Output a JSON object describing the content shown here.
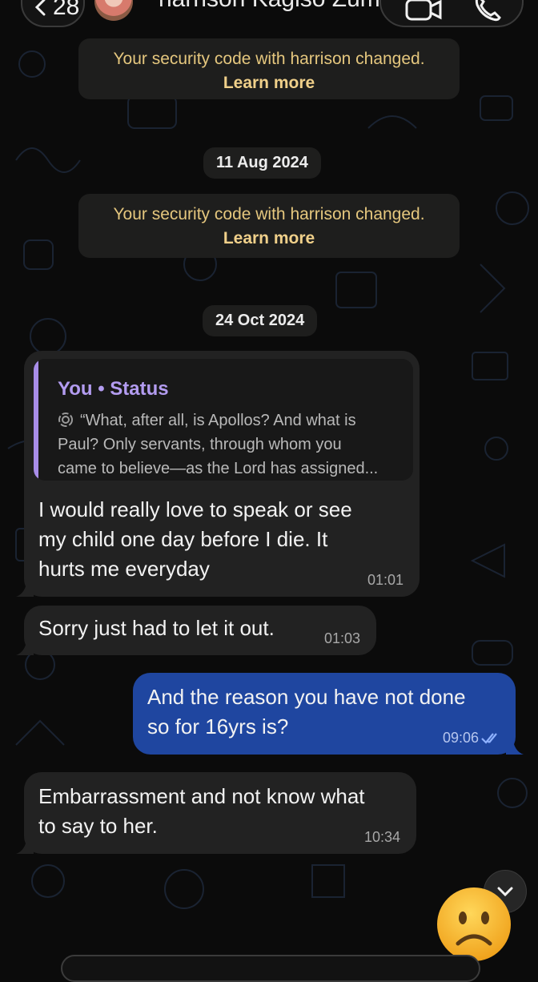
{
  "header": {
    "back_count": "28",
    "contact_name": "harrison Kagiso Zuma"
  },
  "notices": [
    {
      "text": "Your security code with harrison changed.",
      "link": "Learn more"
    },
    {
      "text": "Your security code with harrison changed.",
      "link": "Learn more"
    }
  ],
  "dates": [
    "11 Aug 2024",
    "24 Oct 2024"
  ],
  "quoted_status": {
    "title": "You • Status",
    "lines": [
      "“What, after all, is Apollos? And what is",
      "Paul? Only servants, through whom you",
      "came to believe—as the Lord has assigned..."
    ]
  },
  "messages": [
    {
      "direction": "incoming",
      "lines": [
        "I would really love to speak or see",
        "my child one day before I die. It",
        "hurts me everyday"
      ],
      "time": "01:01"
    },
    {
      "direction": "incoming",
      "lines": [
        "Sorry just had to let it out."
      ],
      "time": "01:03"
    },
    {
      "direction": "outgoing",
      "lines": [
        "And the reason you have not done",
        "so for 16yrs is?"
      ],
      "time": "09:06",
      "status": "read"
    },
    {
      "direction": "incoming",
      "lines": [
        "Embarrassment and not know what",
        "to say to her."
      ],
      "time": "10:34"
    }
  ],
  "icons": {
    "back": "chevron-left-icon",
    "video": "video-camera-icon",
    "phone": "phone-icon",
    "status": "status-ring-icon",
    "read": "double-check-icon",
    "scroll_down": "chevron-down-icon",
    "emoji": "frowning-face-emoji"
  },
  "colors": {
    "background": "#0b0b0b",
    "incoming_bubble": "#222222",
    "outgoing_bubble": "#1f46a0",
    "notice_text": "#e5c77e",
    "quote_accent": "#a88de8"
  }
}
